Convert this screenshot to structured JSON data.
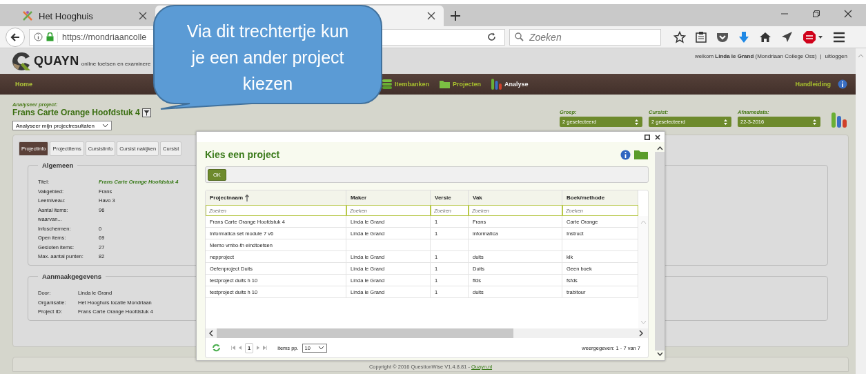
{
  "browser": {
    "tabs": [
      {
        "title": "Het Hooghuis",
        "selected": false
      },
      {
        "selected": true
      }
    ],
    "url": "https://mondriaancolle",
    "search": {
      "placeholder": "Zoeken"
    }
  },
  "header": {
    "logo": "QUAYN",
    "tagline": "online toetsen en examinere",
    "welcome": "welkom **Linda le Grand** (Mondriaan College Oss)",
    "separator": "|",
    "logout": "uitloggen"
  },
  "nav": {
    "home": "Home",
    "items": [
      {
        "label": "Itembanken",
        "kind": "discs",
        "selected": false
      },
      {
        "label": "Projecten",
        "kind": "folder",
        "selected": false
      },
      {
        "label": "Analyse",
        "kind": "bars",
        "selected": true
      }
    ],
    "help": "Handleiding"
  },
  "project": {
    "label": "Analyseer project:",
    "title": "Frans Carte Orange Hoofdstuk 4",
    "mode": "Analyseer mijn projectresultaten"
  },
  "filters": [
    {
      "label": "Groep:",
      "value": "2 geselecteerd"
    },
    {
      "label": "Cursist:",
      "value": "2 geselecteerd"
    },
    {
      "label": "Afnamedata:",
      "value": "22-3-2016"
    }
  ],
  "tabs": [
    {
      "label": "Projectinfo",
      "selected": true
    },
    {
      "label": "Projectitems",
      "selected": false
    },
    {
      "label": "Cursistinfo",
      "selected": false
    },
    {
      "label": "Cursist nakijken",
      "selected": false
    },
    {
      "label": "Cursist",
      "selected": false
    }
  ],
  "sections": [
    {
      "title": "Algemeen",
      "rows": [
        {
          "label": "Titel:",
          "value": "Frans Carte Orange Hoofdstuk 4",
          "highlight": true
        },
        {
          "label": "Vakgebied:",
          "value": "Frans",
          "highlight": false
        },
        {
          "label": "Leerniveau:",
          "value": "Havo 3",
          "highlight": false
        },
        {
          "label": "Aantal items:",
          "value": "96",
          "highlight": false
        },
        {
          "label": "waarvan..."
        },
        {
          "label": "Infoschermen:",
          "value": "0",
          "highlight": false
        },
        {
          "label": "Open items:",
          "value": "69",
          "highlight": false
        },
        {
          "label": "Gesloten items:",
          "value": "27",
          "highlight": false
        },
        {
          "label": "Max. aantal punten:",
          "value": "82",
          "highlight": false
        }
      ]
    },
    {
      "title": "Aanmaakgegevens",
      "rows": [
        {
          "label": "Door:",
          "value": "Linda le Grand",
          "highlight": false
        },
        {
          "label": "Organisatie:",
          "value": "Het Hooghuis locatie Mondriaan",
          "highlight": false
        },
        {
          "label": "Project ID:",
          "value": "Frans Carte Orange Hoofdstuk 4",
          "highlight": false
        }
      ]
    }
  ],
  "footer": {
    "text": "Copyright © 2016 QuestionWise V1.4.8.81 - ",
    "link": "Quayn.nl"
  },
  "dialog": {
    "title": "Kies een project",
    "ok": "OK",
    "table": {
      "columns": [
        {
          "label": "Projectnaam",
          "sorted": true,
          "filter_placeholder": "Zoeken"
        },
        {
          "label": "Maker",
          "sorted": false,
          "filter_placeholder": "Zoeken"
        },
        {
          "label": "Versie",
          "sorted": false,
          "filter_placeholder": "Zoeken"
        },
        {
          "label": "Vak",
          "sorted": false,
          "filter_placeholder": "Zoeken"
        },
        {
          "label": "Boek/methode",
          "sorted": false,
          "filter_placeholder": "Zoeken"
        }
      ],
      "rows": [
        [
          "Frans Carte Orange Hoofdstuk 4",
          "Linda le Grand",
          "1",
          "Frans",
          "Carte Orange"
        ],
        [
          "Informatica set module 7 v6",
          "Linda le Grand",
          "1",
          "informatica",
          "Instruct"
        ],
        [
          "Memo vmbo-th eindtoetsen",
          null,
          null,
          null,
          null
        ],
        [
          "nepproject",
          "Linda le Grand",
          "1",
          "duits",
          "klk"
        ],
        [
          "Oefenproject Duits",
          "Linda le Grand",
          "1",
          "Duits",
          "Geen boek"
        ],
        [
          "testproject duits h 10",
          "Linda le Grand",
          "1",
          "ffds",
          "fsfds"
        ],
        [
          "testproject duits h 10",
          "Linda le Grand",
          "1",
          "duits",
          "trabitour"
        ]
      ]
    },
    "pager": {
      "page": "1",
      "per_page_label": "items pp.",
      "per_page": "10",
      "summary": "weergegeven: 1 - 7 van 7"
    }
  },
  "callout": {
    "text": "Via dit trechtertje kun je een ander project kiezen"
  }
}
